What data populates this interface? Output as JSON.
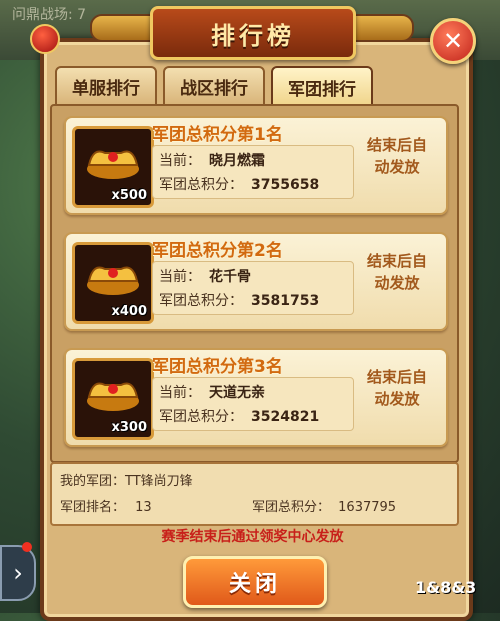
{
  "background": {
    "text": "问鼎战场: 7"
  },
  "title": "排行榜",
  "tabs": [
    {
      "label": "单服排行",
      "active": false
    },
    {
      "label": "战区排行",
      "active": false
    },
    {
      "label": "军团排行",
      "active": true
    }
  ],
  "rewards": [
    {
      "rank_title": "军团总积分第1名",
      "current_label": "当前：",
      "current_name": "晓月燃霜",
      "score_label": "军团总积分：",
      "score": "3755658",
      "count": "x500",
      "claim": "结束后自动发放"
    },
    {
      "rank_title": "军团总积分第2名",
      "current_label": "当前：",
      "current_name": "花千骨",
      "score_label": "军团总积分：",
      "score": "3581753",
      "count": "x400",
      "claim": "结束后自动发放"
    },
    {
      "rank_title": "军团总积分第3名",
      "current_label": "当前：",
      "current_name": "天道无亲",
      "score_label": "军团总积分：",
      "score": "3524821",
      "count": "x300",
      "claim": "结束后自动发放"
    }
  ],
  "my_guild": {
    "name_label": "我的军团：",
    "name": "TT锋尚刀锋",
    "rank_label": "军团排名：",
    "rank": "13",
    "score_label": "军团总积分：",
    "score": "1637795"
  },
  "notice": "赛季结束后通过领奖中心发放",
  "close_button": "关闭",
  "watermark": "1&8&3",
  "colors": {
    "accent_title": "#d26a10",
    "notice_red": "#c8201a",
    "button_orange": "#e0591a"
  }
}
